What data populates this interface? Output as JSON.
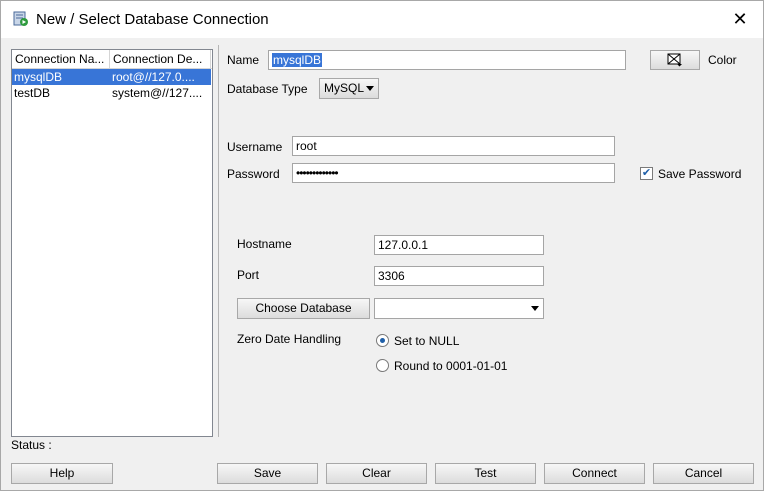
{
  "window": {
    "title": "New / Select Database Connection"
  },
  "list": {
    "headers": [
      "Connection Na...",
      "Connection De..."
    ],
    "rows": [
      {
        "name": "mysqlDB",
        "details": "root@//127.0...."
      },
      {
        "name": "testDB",
        "details": "system@//127...."
      }
    ]
  },
  "form": {
    "name_label": "Name",
    "name_value": "mysqlDB",
    "color_label": "Color",
    "dbtype_label": "Database Type",
    "dbtype_value": "MySQL",
    "username_label": "Username",
    "username_value": "root",
    "password_label": "Password",
    "password_value": "•••••••••••••",
    "save_password_label": "Save Password",
    "hostname_label": "Hostname",
    "hostname_value": "127.0.0.1",
    "port_label": "Port",
    "port_value": "3306",
    "choose_db_label": "Choose Database",
    "zero_date_label": "Zero Date Handling",
    "radio_null": "Set to NULL",
    "radio_round": "Round to 0001-01-01"
  },
  "status": {
    "label": "Status :"
  },
  "buttons": {
    "help": "Help",
    "save": "Save",
    "clear": "Clear",
    "test": "Test",
    "connect": "Connect",
    "cancel": "Cancel"
  },
  "colors": {
    "selection": "#3875d7"
  }
}
